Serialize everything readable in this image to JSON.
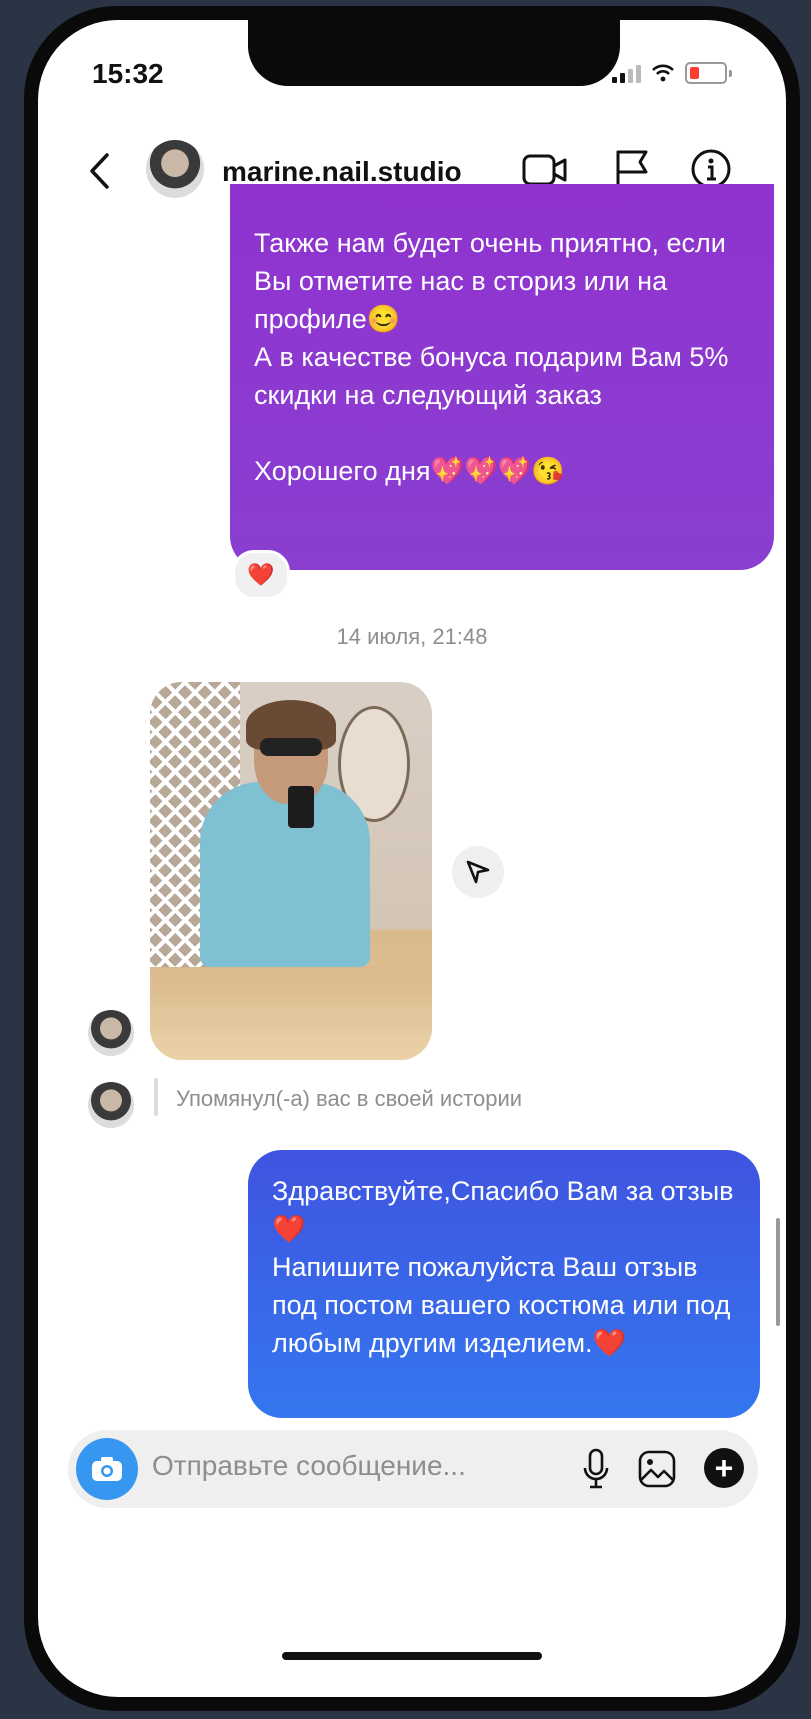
{
  "status_bar": {
    "time": "15:32"
  },
  "header": {
    "username": "marine.nail.studio"
  },
  "messages": {
    "outgoing_1": "Также нам будет очень приятно, если Вы отметите нас в сториз или на профиле😊\nА в качестве бонуса подарим Вам 5% скидки на следующий заказ\n\nХорошего дня💖💖💖😘",
    "reaction": "❤️",
    "date_separator": "14 июля, 21:48",
    "story_mention": "Упомянул(-а) вас в своей истории",
    "outgoing_2": "Здравствуйте,Спасибо Вам за отзыв ❤️\nНапишите пожалуйста Ваш отзыв под постом вашего костюма или под любым другим изделием.❤️"
  },
  "composer": {
    "placeholder": "Отправьте сообщение..."
  },
  "colors": {
    "purple_bubble": "#8f33cf",
    "blue_bubble": "#3477ef",
    "camera_button": "#3797f0",
    "background": "#2b3444"
  },
  "icons": [
    "back-chevron-icon",
    "video-call-icon",
    "flag-icon",
    "info-icon",
    "share-icon",
    "camera-icon",
    "microphone-icon",
    "gallery-icon",
    "plus-icon"
  ]
}
